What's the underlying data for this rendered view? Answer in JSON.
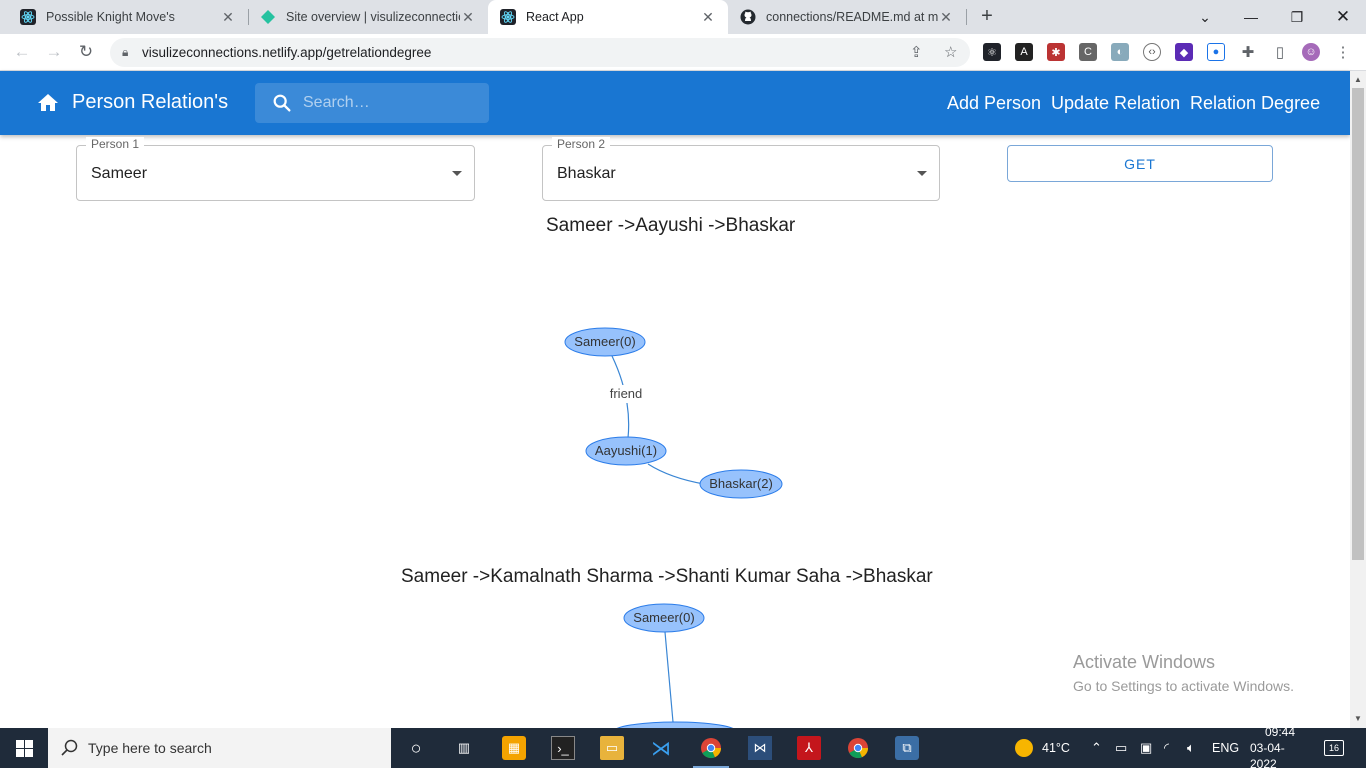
{
  "browser": {
    "tabs": [
      {
        "title": "Possible Knight Move's",
        "favicon": "react-icon",
        "active": false
      },
      {
        "title": "Site overview | visulizeconnection",
        "favicon": "netlify-icon",
        "active": false
      },
      {
        "title": "React App",
        "favicon": "react-icon",
        "active": true
      },
      {
        "title": "connections/README.md at mas",
        "favicon": "github-icon",
        "active": false
      }
    ],
    "url": "visulizeconnections.netlify.app/getrelationdegree"
  },
  "appbar": {
    "brand": "Person Relation's",
    "search_placeholder": "Search…",
    "nav": [
      "Add Person",
      "Update Relation",
      "Relation Degree"
    ],
    "color": "#1976d2"
  },
  "form": {
    "person1": {
      "label": "Person 1",
      "value": "Sameer"
    },
    "person2": {
      "label": "Person 2",
      "value": "Bhaskar"
    },
    "get_label": "GET"
  },
  "results": [
    {
      "path_text": "Sameer ->Aayushi ->Bhaskar",
      "nodes": [
        "Sameer(0)",
        "Aayushi(1)",
        "Bhaskar(2)"
      ],
      "edge_labels": [
        "friend",
        ""
      ]
    },
    {
      "path_text": "Sameer ->Kamalnath Sharma ->Shanti Kumar Saha ->Bhaskar",
      "nodes": [
        "Sameer(0)"
      ],
      "edge_labels": []
    }
  ],
  "node_color": "#97c2fc",
  "watermark": {
    "line1": "Activate Windows",
    "line2": "Go to Settings to activate Windows."
  },
  "taskbar": {
    "search_text": "Type here to search",
    "weather": "41°C",
    "lang": "ENG",
    "time": "09:44",
    "date": "03-04-2022",
    "notifications": "16"
  }
}
